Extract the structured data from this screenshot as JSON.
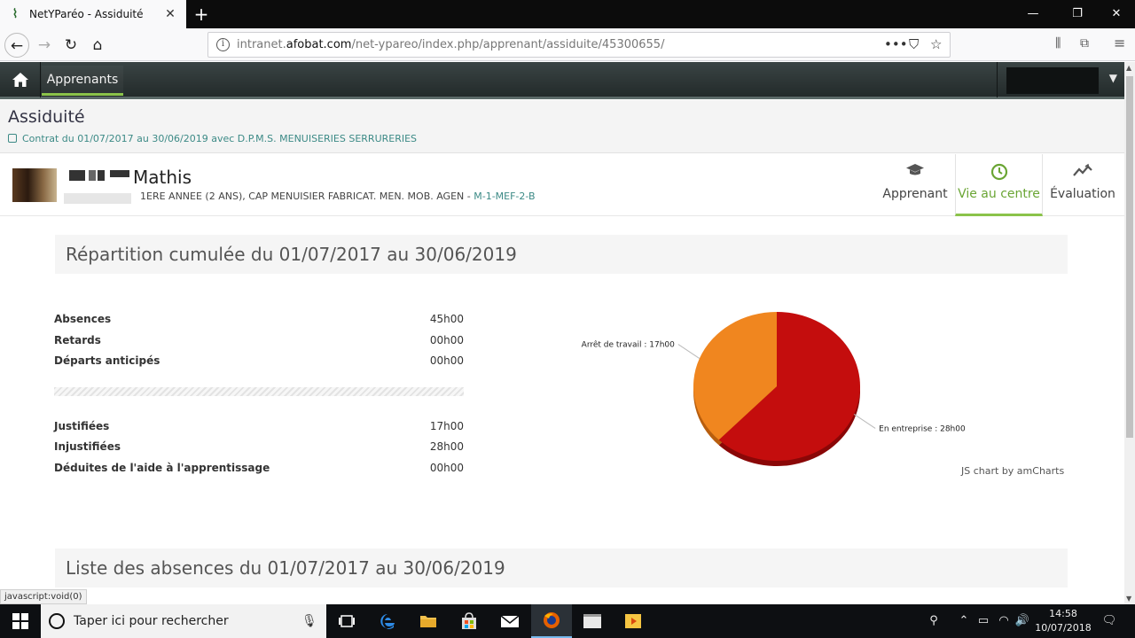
{
  "browser": {
    "tab_title": "NetYParéo - Assiduité",
    "url_prefix": "intranet.",
    "url_domain": "afobat.com",
    "url_path": "/net-ypareo/index.php/apprenant/assiduite/45300655/",
    "status_url": "javascript:void(0)"
  },
  "app": {
    "nav_item": "Apprenants"
  },
  "page": {
    "title": "Assiduité",
    "contract": "Contrat du 01/07/2017 au 30/06/2019 avec D.P.M.S. MENUISERIES SERRURERIES"
  },
  "student": {
    "name": "Mathis",
    "class_text": "1ERE ANNEE (2 ANS), CAP MENUISIER FABRICAT. MEN. MOB. AGEN - ",
    "class_code": "M-1-MEF-2-B"
  },
  "student_tabs": [
    {
      "label": "Apprenant"
    },
    {
      "label": "Vie au centre"
    },
    {
      "label": "Évaluation"
    }
  ],
  "section1": {
    "title": "Répartition cumulée du 01/07/2017 au 30/06/2019"
  },
  "stats_top": [
    {
      "label": "Absences",
      "value": "45h00"
    },
    {
      "label": "Retards",
      "value": "00h00"
    },
    {
      "label": "Départs anticipés",
      "value": "00h00"
    }
  ],
  "stats_bottom": [
    {
      "label": "Justifiées",
      "value": "17h00"
    },
    {
      "label": "Injustifiées",
      "value": "28h00"
    },
    {
      "label": "Déduites de l'aide à l'apprentissage",
      "value": "00h00"
    }
  ],
  "chart_data": {
    "type": "pie",
    "slices": [
      {
        "label": "Arrêt de travail : 17h00",
        "value": 17,
        "color": "#f0861f"
      },
      {
        "label": "En entreprise : 28h00",
        "value": 28,
        "color": "#c40d0d"
      }
    ],
    "credit": "JS chart by amCharts"
  },
  "section2": {
    "title": "Liste des absences du 01/07/2017 au 30/06/2019"
  },
  "taskbar": {
    "search_placeholder": "Taper ici pour rechercher",
    "time": "14:58",
    "date": "10/07/2018"
  }
}
